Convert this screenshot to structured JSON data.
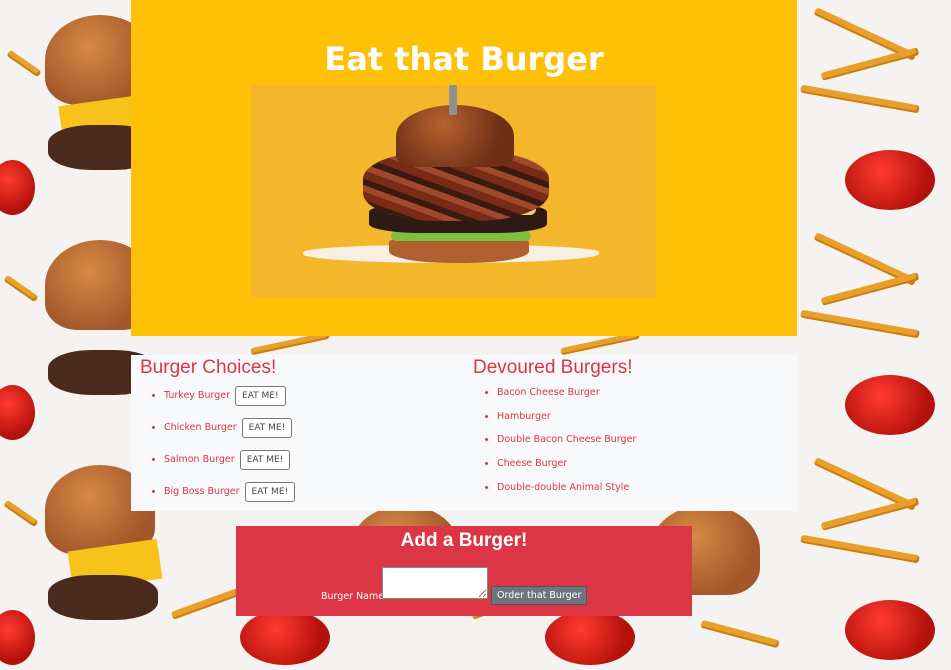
{
  "header": {
    "title": "Eat that Burger"
  },
  "choices": {
    "heading": "Burger Choices!",
    "items": [
      {
        "name": "Turkey Burger",
        "button": "EAT ME!"
      },
      {
        "name": "Chicken Burger",
        "button": "EAT ME!"
      },
      {
        "name": "Salmon Burger",
        "button": "EAT ME!"
      },
      {
        "name": "Big Boss Burger",
        "button": "EAT ME!"
      }
    ]
  },
  "devoured": {
    "heading": "Devoured Burgers!",
    "items": [
      "Bacon Cheese Burger",
      "Hamburger",
      "Double Bacon Cheese Burger",
      "Cheese Burger",
      "Double-double Animal Style"
    ]
  },
  "add_form": {
    "heading": "Add a Burger!",
    "label": "Burger Name:",
    "input_value": "",
    "submit_label": "Order that Burger"
  },
  "colors": {
    "header_bg": "#ffc107",
    "accent_red": "#dc3545",
    "panel_bg": "#f8f9fa",
    "submit_bg": "#6c757d"
  }
}
